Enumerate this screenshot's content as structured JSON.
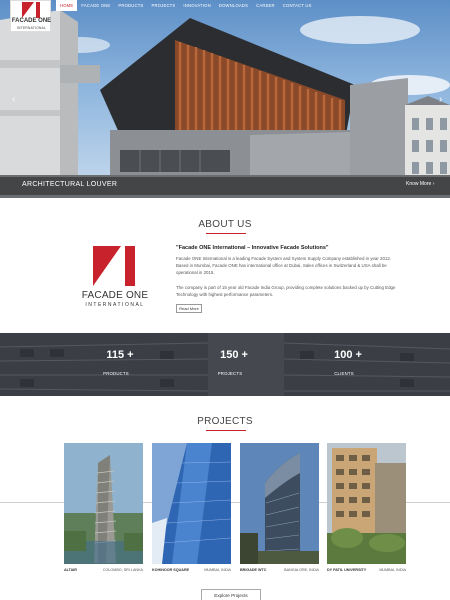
{
  "header": {
    "logo": {
      "name": "FACADE ONE",
      "sub": "INTERNATIONAL"
    },
    "nav": [
      "HOME",
      "FACADE ONE",
      "PRODUCTS",
      "PROJECTS",
      "INNOVATION",
      "DOWNLOADS",
      "CAREER",
      "CONTACT US"
    ],
    "active_nav": "HOME"
  },
  "hero": {
    "caption": "ARCHITECTURAL LOUVER",
    "more_label": "Know More",
    "more_icon": "chevron-right-icon",
    "prev_icon": "chevron-left-icon",
    "next_icon": "chevron-right-icon"
  },
  "about": {
    "title": "ABOUT US",
    "logo": {
      "name": "FACADE ONE",
      "sub": "INTERNATIONAL"
    },
    "heading": "\"Facade ONE International – Innovative Facade Solutions\"",
    "p1": "Facade ONE International is a leading Facade System and System Supply Company established in year 2012. Based in Mumbai, Facade ONE has international office at Dubai, Sales offices in Switzerland & USA shall be operational in 2015.",
    "p2": "The company is part of 15 year old Facade India Group, providing complete solutions backed up by Cutting Edge Technology with highest performance parameters.",
    "read_more": "Read More"
  },
  "stats": [
    {
      "value": "115 +",
      "label": "PRODUCTS"
    },
    {
      "value": "150 +",
      "label": "PROJECTS"
    },
    {
      "value": "100 +",
      "label": "CLIENTS"
    }
  ],
  "projects": {
    "title": "PROJECTS",
    "items": [
      {
        "name": "ALTAIR",
        "location": "COLOMBO, SRI LANKA"
      },
      {
        "name": "KOHINOOR SQUARE",
        "location": "MUMBAI, INDIA"
      },
      {
        "name": "BRIGADE WTC",
        "location": "BANGALORE, INDIA"
      },
      {
        "name": "DY PATIL UNIVERSITY",
        "location": "MUMBAI, INDIA"
      }
    ],
    "explore_label": "Explore Projects"
  },
  "colors": {
    "brand_red": "#c8232c",
    "stats_bg": "#3a3e44",
    "text": "#333333"
  }
}
